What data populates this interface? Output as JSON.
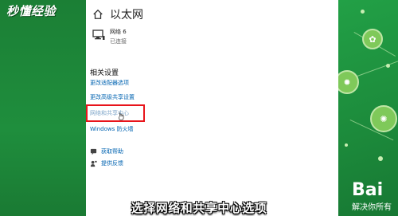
{
  "watermark": {
    "text": "秒懂经验"
  },
  "window": {
    "title": "以太网"
  },
  "network": {
    "name": "网络 6",
    "status": "已连接"
  },
  "related": {
    "heading": "相关设置",
    "links": [
      "更改适配器选项",
      "更改高级共享设置",
      "网络和共享中心",
      "Windows 防火墙"
    ]
  },
  "help": {
    "get_help": "获取帮助",
    "feedback": "提供反馈"
  },
  "subtitle": "选择网络和共享中心选项",
  "brand": {
    "logo": "Bai",
    "tagline": "解决你所有"
  },
  "colors": {
    "highlight": "#e8141b",
    "link": "#0063b1",
    "background": "#1e8a3a"
  }
}
